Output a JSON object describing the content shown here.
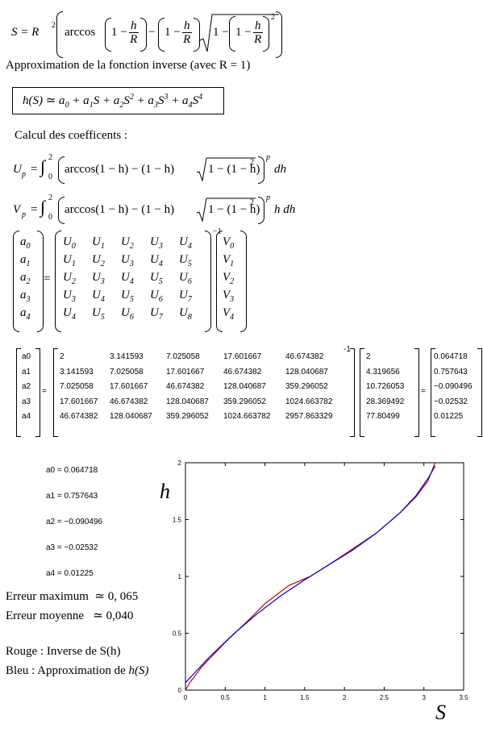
{
  "formula_S": {
    "lhs": "S = R",
    "exp": "2",
    "arccos": "arccos",
    "one": "1",
    "h": "h",
    "R": "R",
    "sq": "2"
  },
  "approx_title": "Approximation de la fonction inverse (avec R = 1)",
  "poly": {
    "text": "h(S) ≃ a",
    "parts": [
      "h(S) ≃ a",
      "0",
      " + a",
      "1",
      "S + a",
      "2",
      "S",
      "2",
      " + a",
      "3",
      "S",
      "3",
      " + a",
      "4",
      "S",
      "4"
    ]
  },
  "coef_title": "Calcul des coefficents :",
  "up_formula": {
    "lhs": "U",
    "sub": "p",
    "int_upper": "2",
    "int_lower": "0",
    "body": "arccos(1 − h) − (1 − h)",
    "root": "1 − (1 − h)",
    "sq": "2",
    "pow": "p",
    "tail": "dh"
  },
  "vp_formula": {
    "lhs": "V",
    "sub": "p",
    "int_upper": "2",
    "int_lower": "0",
    "body": "arccos(1 − h) − (1 − h)",
    "root": "1 − (1 − h)",
    "sq": "2",
    "pow": "p",
    "tail": "h dh"
  },
  "sym_matrix": {
    "a": [
      "a0",
      "a1",
      "a2",
      "a3",
      "a4"
    ],
    "U": [
      [
        "U0",
        "U1",
        "U2",
        "U3",
        "U4"
      ],
      [
        "U1",
        "U2",
        "U3",
        "U4",
        "U5"
      ],
      [
        "U2",
        "U3",
        "U4",
        "U5",
        "U6"
      ],
      [
        "U3",
        "U4",
        "U5",
        "U6",
        "U7"
      ],
      [
        "U4",
        "U5",
        "U6",
        "U7",
        "U8"
      ]
    ],
    "V": [
      "V0",
      "V1",
      "V2",
      "V3",
      "V4"
    ],
    "inv": "−1"
  },
  "num_matrix": {
    "labels": [
      "a0",
      "a1",
      "a2",
      "a3",
      "a4"
    ],
    "U": [
      [
        "2",
        "3.141593",
        "7.025058",
        "17.601667",
        "46.674382"
      ],
      [
        "3.141593",
        "7.025058",
        "17.601667",
        "46.674382",
        "128.040687"
      ],
      [
        "7.025058",
        "17.601667",
        "46.674382",
        "128.040687",
        "359.296052"
      ],
      [
        "17.601667",
        "46.674382",
        "128.040687",
        "359.296052",
        "1024.663782"
      ],
      [
        "46.674382",
        "128.040687",
        "359.296052",
        "1024.663782",
        "2957.863329"
      ]
    ],
    "inv": "-1",
    "V": [
      "2",
      "4.319656",
      "10.726053",
      "28.369492",
      "77.80499"
    ],
    "result": [
      "0.064718",
      "0.757643",
      "−0.090496",
      "−0.02532",
      "0.01225"
    ]
  },
  "coeffs": [
    "a0 = 0.064718",
    "a1 = 0.757643",
    "a2 = −0.090496",
    "a3 = −0.02532",
    "a4 = 0.01225"
  ],
  "errors": {
    "max_label": "Erreur maximum",
    "max_val": "≃ 0, 065",
    "mean_label": "Erreur moyenne",
    "mean_val": "≃ 0,040"
  },
  "legend": {
    "red": "Rouge : Inverse de S(h)",
    "blue_label": "Bleu : Approximation de ",
    "blue_fn": "h(S)"
  },
  "chart_data": {
    "type": "line",
    "xlabel": "S",
    "ylabel": "h",
    "xlim": [
      0,
      3.5
    ],
    "ylim": [
      0,
      2
    ],
    "xticks": [
      "0",
      "0.5",
      "1",
      "1.5",
      "2",
      "2.5",
      "3",
      "3.5"
    ],
    "yticks": [
      "0",
      "0.5",
      "1",
      "1.5",
      "2"
    ],
    "series": [
      {
        "color": "#cc0000",
        "x": [
          0,
          0.05,
          0.2,
          0.5,
          0.8,
          1.0,
          1.3,
          1.57,
          1.8,
          2.1,
          2.4,
          2.7,
          2.9,
          3.05,
          3.1416
        ],
        "y": [
          0,
          0.06,
          0.2,
          0.42,
          0.62,
          0.76,
          0.92,
          1.0,
          1.1,
          1.24,
          1.38,
          1.56,
          1.7,
          1.84,
          2.0
        ]
      },
      {
        "color": "#0000cc",
        "x": [
          0,
          0.1,
          0.3,
          0.6,
          0.9,
          1.2,
          1.5,
          1.8,
          2.1,
          2.4,
          2.7,
          2.9,
          3.05,
          3.1416
        ],
        "y": [
          0.065,
          0.14,
          0.29,
          0.49,
          0.67,
          0.83,
          0.97,
          1.1,
          1.23,
          1.38,
          1.56,
          1.71,
          1.86,
          1.97
        ]
      }
    ],
    "grid": false
  }
}
